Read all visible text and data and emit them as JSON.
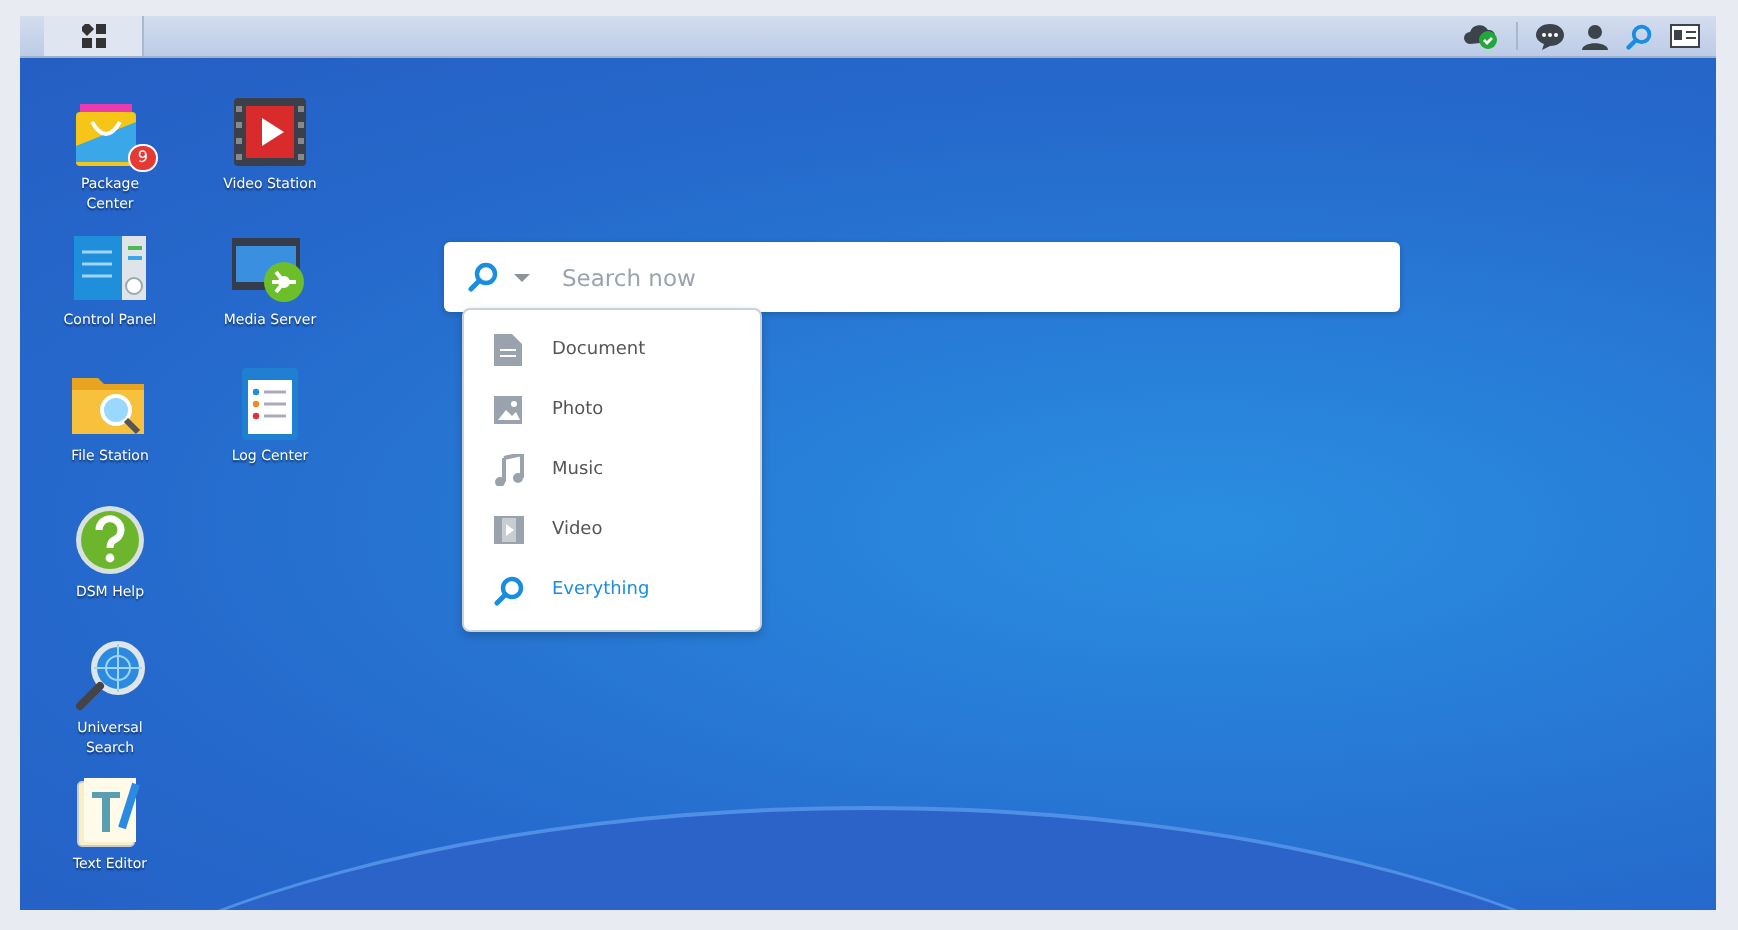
{
  "desktop": {
    "columns": [
      [
        {
          "kind": "package",
          "label": "Package Center",
          "badge": "9"
        },
        {
          "kind": "control",
          "label": "Control Panel"
        },
        {
          "kind": "folder",
          "label": "File Station"
        },
        {
          "kind": "help",
          "label": "DSM Help"
        },
        {
          "kind": "usearch",
          "label": "Universal Search"
        },
        {
          "kind": "editor",
          "label": "Text Editor"
        }
      ],
      [
        {
          "kind": "video",
          "label": "Video Station"
        },
        {
          "kind": "media",
          "label": "Media Server"
        },
        {
          "kind": "log",
          "label": "Log Center"
        }
      ]
    ]
  },
  "search": {
    "placeholder": "Search now",
    "menu": [
      {
        "kind": "document",
        "label": "Document",
        "selected": false
      },
      {
        "kind": "photo",
        "label": "Photo",
        "selected": false
      },
      {
        "kind": "music",
        "label": "Music",
        "selected": false
      },
      {
        "kind": "video",
        "label": "Video",
        "selected": false
      },
      {
        "kind": "everything",
        "label": "Everything",
        "selected": true
      }
    ]
  }
}
